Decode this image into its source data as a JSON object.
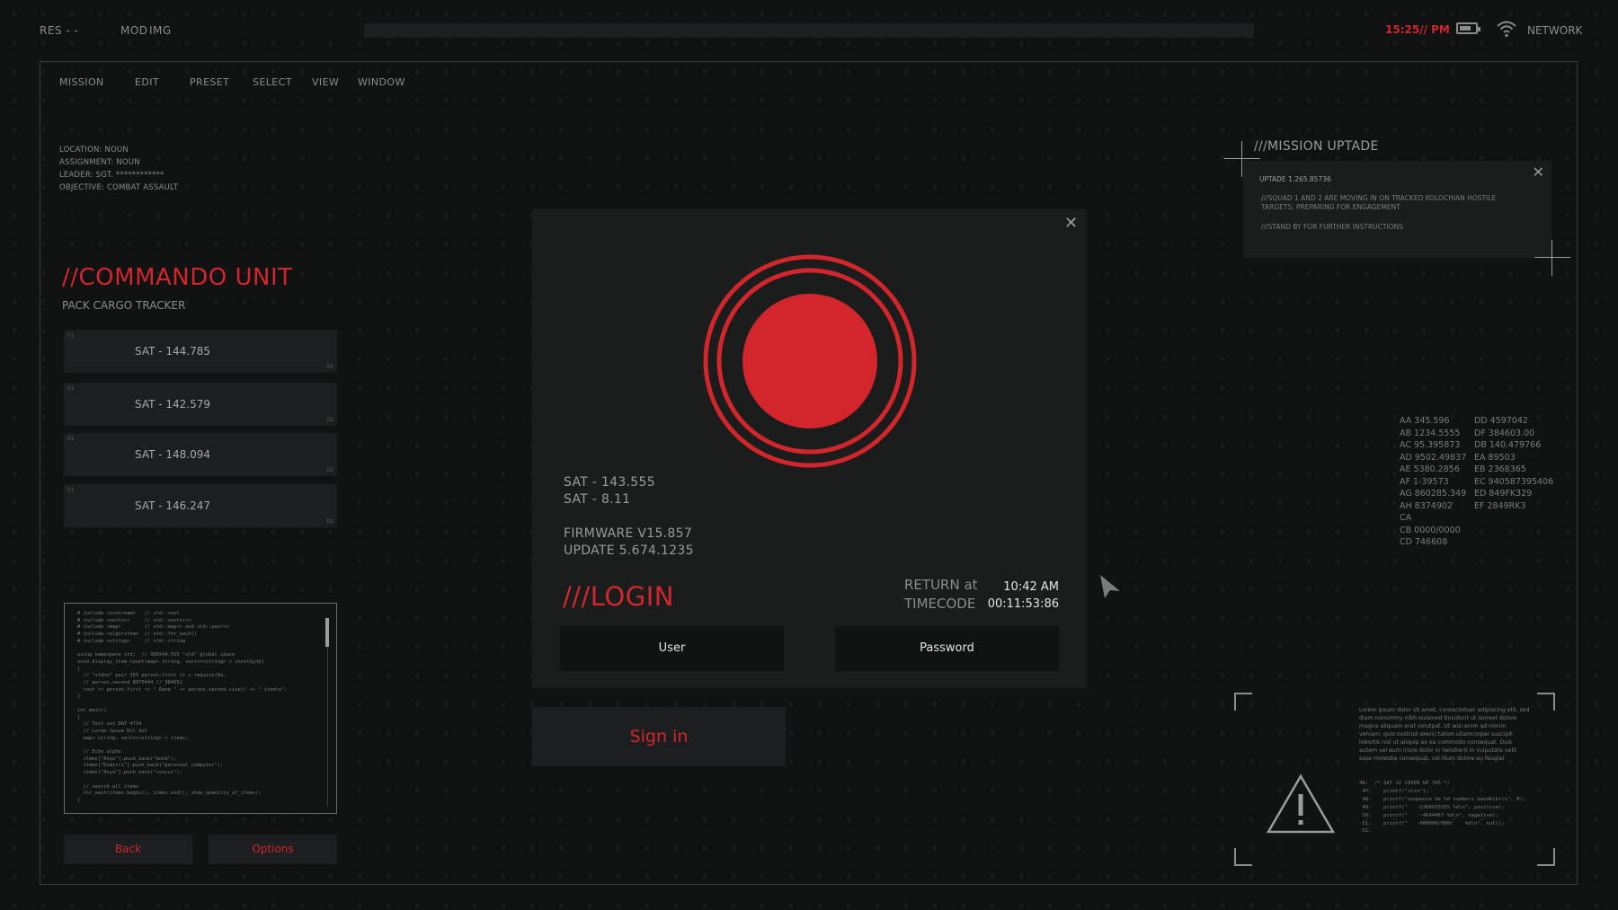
{
  "topbar": {
    "res_label": "RES - -",
    "mod_label": "MOD",
    "img_label": "IMG",
    "clock": "15:25// PM",
    "network_label": "NETWORK",
    "battery_level": 0.75
  },
  "menu": [
    "MISSION",
    "EDIT",
    "PRESET",
    "SELECT",
    "VIEW",
    "WINDOW"
  ],
  "mission_info": {
    "location": "LOCATION: NOUN",
    "assignment": "ASSIGNMENT: NOUN",
    "leader": "LEADER: SGT. ************",
    "objective": "OBJECTIVE: COMBAT ASSAULT"
  },
  "unit": {
    "title": "//COMMANDO UNIT",
    "subtitle": "PACK CARGO TRACKER",
    "cards": [
      {
        "label": "SAT - 144.785",
        "tl": "01",
        "br": "02"
      },
      {
        "label": "SAT - 142.579",
        "tl": "01",
        "br": "02"
      },
      {
        "label": "SAT - 148.094",
        "tl": "01",
        "br": "02"
      },
      {
        "label": "SAT - 146.247",
        "tl": "01",
        "br": "02"
      }
    ]
  },
  "code_panel": {
    "text": "# include <iostream>   // std::cout\n# include <vector>     // std::vector<>\n# include <map>        // std::map<> and std::pair<>\n# include <algorithm>  // std::for_each()\n# include <string>     // std::string\n\nusing namespace std;  // 986544.555 \"std\" global space\nvoid display_item_count(map< string, vector<string> > const&job)\n{\n  // \"stdno\" pair 355 person.first it x require(6a,\n  // person.second 8075444 // 984652\n  cout << person.first << \" Dane \" << person.second.size() << \" item\\n\";\n}\n\nint main()\n{\n  // Test set DAT 4734\n  // Lorem ipsum Dol dot\n  map< string, vector<string> > items;\n\n  // Echo alpha\n  items[\"Anya\"].push_back(\"book\");\n  items[\"Dimitri\"].push_back(\"personal computer\");\n  items[\"Anya\"].push_back(\"couscs\");\n\n  // search all items\n  for_each(items.begin(), items.end(), show_quantity_of_items);\n}"
  },
  "buttons": {
    "back": "Back",
    "options": "Options"
  },
  "modal": {
    "sat_a": "SAT - 143.555",
    "sat_b": "SAT - 8.11",
    "firmware": "FIRMWARE V15.857",
    "update": "UPDATE 5.674.1235",
    "login_title": "///LOGIN",
    "return_label": "RETURN at",
    "timecode_label": "TIMECODE",
    "return_value": "10:42 AM",
    "timecode_value": "00:11:53:86",
    "user_label": "User",
    "password_label": "Password",
    "signin_label": "Sign in"
  },
  "mission_update": {
    "title": "///MISSION UPTADE",
    "header": "UPTADE 1.265.85736",
    "line1": "///SQUAD 1 AND 2 ARE MOVING IN ON TRACKED KOLOCHIAN HOSTILE TARGETS, PREPARING FOR ENGAGEMENT",
    "line2": "///STAND BY FOR FURTHER INSTRUCTIONS"
  },
  "codes_left": [
    "AA 345.596",
    "AB 1234.5555",
    "AC 95.395873",
    "AD 9502.49837",
    "AE 5380.2856",
    "AF 1-39573",
    "AG 860285.349",
    "AH 8374902",
    "CA",
    "CB 0000/0000",
    "CD 746608"
  ],
  "codes_right": [
    "DD 4597042",
    "DF 384603.00",
    "DB 140.479766",
    "EA 89503",
    "EB 2368365",
    "EC 940587395406",
    "ED 849FK329",
    "EF 2849RK3"
  ],
  "lorem": "Lorem ipsum dolor sit amet, consectetuer adipiscing elit, sed diam nonummy nibh euismod tincidunt ut laoreet dolore magna aliquam erat volutpat. Ut wisi enim ad minim veniam, quis nostrud exerci tation ullamcorper suscipit lobortis nisl ut aliquip ex ea commodo consequat. Duis autem vel eum iriure dolor in hendrerit in vulputate velit esse molestie consequat, vel illum dolore eu feugiat",
  "small_code": "46:  /* SAT 12 COVER UP 345 */\n 47:    printf(\"stio\");\n 48:    printf(\"sequence de %d numbers bandkibr\\n\", N);\n 49:    printf(\"   -2368933355 %d\\n\", positive);\n 50:    printf(\"    -4644467 %d\\n\", negative);\n 51:    printf(\"   -000000/000c    %d\\n\", null);\n 52:",
  "colors": {
    "accent": "#d2262c",
    "background": "#111212",
    "panel": "#1b1c1c",
    "text": "#8a8c8d"
  },
  "icons": [
    "battery-icon",
    "wifi-icon",
    "close-icon",
    "record-icon",
    "cursor-icon",
    "warning-icon",
    "crosshair-icon"
  ]
}
